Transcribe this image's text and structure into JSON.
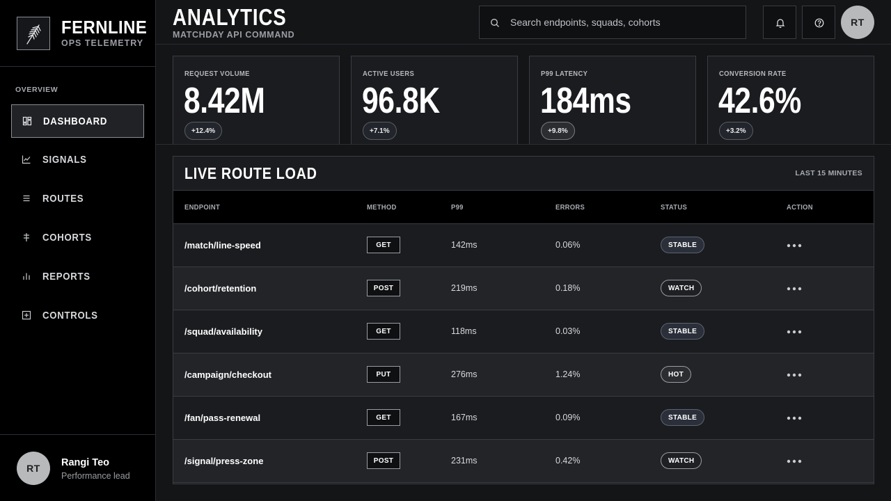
{
  "brand": {
    "name": "FERNLINE",
    "subtitle": "OPS TELEMETRY",
    "logo_icon": "feather-icon"
  },
  "sidebar": {
    "section_label": "OVERVIEW",
    "items": [
      {
        "label": "DASHBOARD",
        "icon": "dashboard-icon",
        "active": true
      },
      {
        "label": "SIGNALS",
        "icon": "line-chart-icon",
        "active": false
      },
      {
        "label": "ROUTES",
        "icon": "list-icon",
        "active": false
      },
      {
        "label": "COHORTS",
        "icon": "split-icon",
        "active": false
      },
      {
        "label": "REPORTS",
        "icon": "bar-chart-icon",
        "active": false
      },
      {
        "label": "CONTROLS",
        "icon": "plus-square-icon",
        "active": false
      }
    ],
    "user": {
      "initials": "RT",
      "name": "Rangi Teo",
      "role": "Performance lead"
    }
  },
  "header": {
    "title": "ANALYTICS",
    "subtitle": "MATCHDAY API COMMAND",
    "search_placeholder": "Search endpoints, squads, cohorts",
    "notifications_icon": "bell-icon",
    "help_icon": "help-icon",
    "avatar_initials": "RT"
  },
  "kpis": [
    {
      "label": "REQUEST VOLUME",
      "value": "8.42M",
      "change": "+12.4%"
    },
    {
      "label": "ACTIVE USERS",
      "value": "96.8K",
      "change": "+7.1%"
    },
    {
      "label": "P99 LATENCY",
      "value": "184ms",
      "change": "+9.8%"
    },
    {
      "label": "CONVERSION RATE",
      "value": "42.6%",
      "change": "+3.2%"
    }
  ],
  "table": {
    "title": "LIVE ROUTE LOAD",
    "meta": "LAST 15 MINUTES",
    "columns": {
      "endpoint": "ENDPOINT",
      "method": "METHOD",
      "p99": "P99",
      "errors": "ERRORS",
      "status": "STATUS",
      "action": "ACTION"
    },
    "rows": [
      {
        "endpoint": "/match/line-speed",
        "method": "GET",
        "p99": "142ms",
        "errors": "0.06%",
        "status": "STABLE"
      },
      {
        "endpoint": "/cohort/retention",
        "method": "POST",
        "p99": "219ms",
        "errors": "0.18%",
        "status": "WATCH"
      },
      {
        "endpoint": "/squad/availability",
        "method": "GET",
        "p99": "118ms",
        "errors": "0.03%",
        "status": "STABLE"
      },
      {
        "endpoint": "/campaign/checkout",
        "method": "PUT",
        "p99": "276ms",
        "errors": "1.24%",
        "status": "HOT"
      },
      {
        "endpoint": "/fan/pass-renewal",
        "method": "GET",
        "p99": "167ms",
        "errors": "0.09%",
        "status": "STABLE"
      },
      {
        "endpoint": "/signal/press-zone",
        "method": "POST",
        "p99": "231ms",
        "errors": "0.42%",
        "status": "WATCH"
      }
    ]
  },
  "colors": {
    "background": "#141517",
    "sidebar": "#000000",
    "panel": "#1a1c1f",
    "border": "#3a3c41",
    "text": "#ffffff",
    "muted": "#9a9da3"
  }
}
